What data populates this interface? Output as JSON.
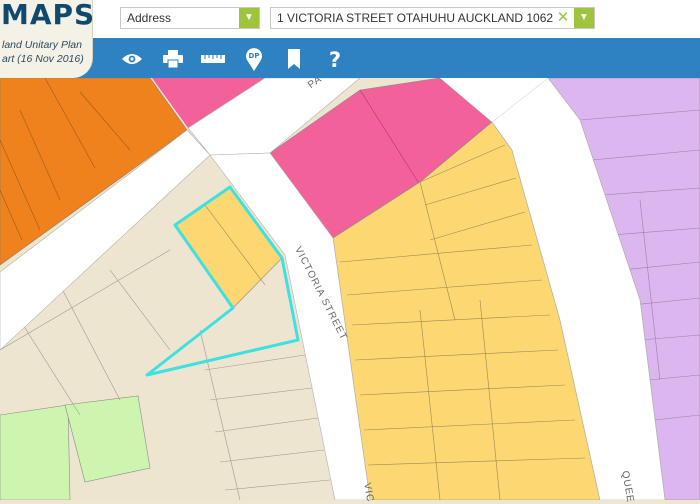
{
  "app": {
    "logo_text": "MAPS",
    "logo_subtitle_line1": "land Unitary Plan",
    "logo_subtitle_line2": "art (16 Nov 2016)"
  },
  "search": {
    "type_value": "Address",
    "address_value": "1 VICTORIA STREET OTAHUHU AUCKLAND 1062"
  },
  "toolbar": {
    "tools": [
      {
        "name": "view-icon"
      },
      {
        "name": "print-icon"
      },
      {
        "name": "measure-icon"
      },
      {
        "name": "dp-pin-icon",
        "label": "DP"
      },
      {
        "name": "bookmark-icon"
      },
      {
        "name": "help-icon"
      }
    ]
  },
  "map": {
    "street_labels": [
      "PA",
      "VICTORIA STREET",
      "VIC",
      "QUEE"
    ],
    "colors": {
      "light_industry": "#f0821e",
      "business_centre": "#f2619a",
      "mixed_use": "#fcd772",
      "residential": "#ede5d0",
      "open_space": "#cdf5b0",
      "special_purpose": "#dcb6ee",
      "road": "#ffffff",
      "boundary": "#8a8a8a",
      "selected": "#3ee0e0"
    }
  }
}
